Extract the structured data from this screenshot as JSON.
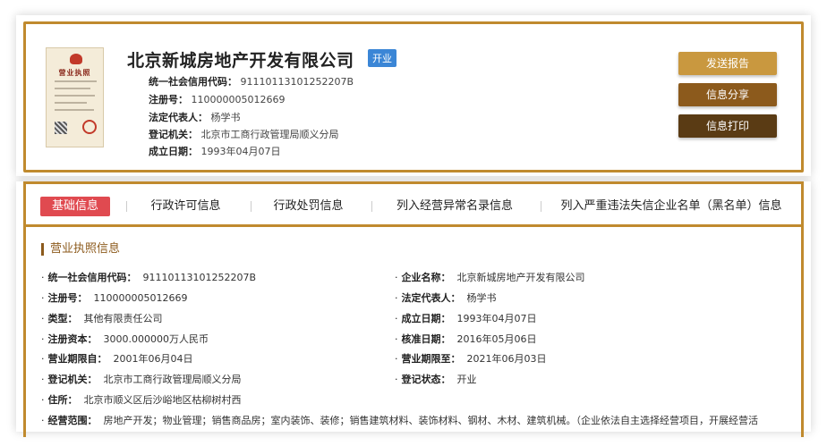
{
  "company": {
    "name": "北京新城房地产开发有限公司",
    "status_tag": "开业",
    "license_title": "营业执照"
  },
  "header_info": [
    {
      "label": "统一社会信用代码：",
      "value": "91110113101252207B"
    },
    {
      "label": "注册号：",
      "value": "110000005012669"
    },
    {
      "label": "法定代表人：",
      "value": "杨学书"
    },
    {
      "label": "登记机关：",
      "value": "北京市工商行政管理局顺义分局"
    },
    {
      "label": "成立日期：",
      "value": "1993年04月07日"
    }
  ],
  "buttons": {
    "send_report": "发送报告",
    "share": "信息分享",
    "print": "信息打印"
  },
  "tabs": [
    "基础信息",
    "行政许可信息",
    "行政处罚信息",
    "列入经营异常名录信息",
    "列入严重违法失信企业名单（黑名单）信息"
  ],
  "section": {
    "title": "营业执照信息"
  },
  "fields_left": [
    {
      "label": "统一社会信用代码：",
      "value": "91110113101252207B"
    },
    {
      "label": "注册号：",
      "value": "110000005012669"
    },
    {
      "label": "类型：",
      "value": "其他有限责任公司"
    },
    {
      "label": "注册资本：",
      "value": "3000.000000万人民币"
    },
    {
      "label": "营业期限自：",
      "value": "2001年06月04日"
    },
    {
      "label": "登记机关：",
      "value": "北京市工商行政管理局顺义分局"
    },
    {
      "label": "住所：",
      "value": "北京市顺义区后沙峪地区枯柳树村西"
    },
    {
      "label": "经营范围：",
      "value": "房地产开发；物业管理；销售商品房；室内装饰、装修；销售建筑材料、装饰材料、钢材、木材、建筑机械。（企业依法自主选择经营项目，开展经营活"
    }
  ],
  "fields_right": [
    {
      "label": "企业名称：",
      "value": "北京新城房地产开发有限公司"
    },
    {
      "label": "法定代表人：",
      "value": "杨学书"
    },
    {
      "label": "成立日期：",
      "value": "1993年04月07日"
    },
    {
      "label": "核准日期：",
      "value": "2016年05月06日"
    },
    {
      "label": "营业期限至：",
      "value": "2021年06月03日"
    },
    {
      "label": "登记状态：",
      "value": "开业"
    }
  ],
  "colors": {
    "gold_border": "#c08a2e",
    "send_button": "#c9983f",
    "share_button": "#8c5a1c",
    "print_button": "#5a3b14",
    "active_tab": "#e04a50",
    "status_tag": "#3b86d6"
  }
}
